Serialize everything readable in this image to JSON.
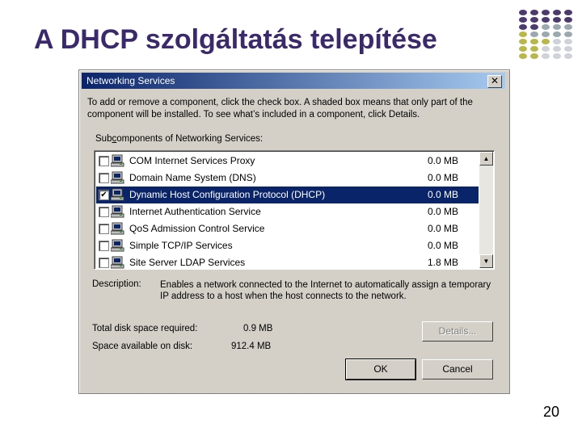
{
  "slide": {
    "title": "A DHCP szolgáltatás telepítése",
    "page_number": "20"
  },
  "dialog": {
    "title": "Networking Services",
    "close_glyph": "✕",
    "description": "To add or remove a component, click the check box. A shaded box means that only part of the component will be installed. To see what’s included in a component, click Details.",
    "subcomponents_label_prefix": "Sub",
    "subcomponents_label_accel": "c",
    "subcomponents_label_rest": "omponents of Networking Services:",
    "components": [
      {
        "name": "COM Internet Services Proxy",
        "size": "0.0 MB",
        "checked": false,
        "selected": false
      },
      {
        "name": "Domain Name System (DNS)",
        "size": "0.0 MB",
        "checked": false,
        "selected": false
      },
      {
        "name": "Dynamic Host Configuration Protocol (DHCP)",
        "size": "0.0 MB",
        "checked": true,
        "selected": true
      },
      {
        "name": "Internet Authentication Service",
        "size": "0.0 MB",
        "checked": false,
        "selected": false
      },
      {
        "name": "QoS Admission Control Service",
        "size": "0.0 MB",
        "checked": false,
        "selected": false
      },
      {
        "name": "Simple TCP/IP Services",
        "size": "0.0 MB",
        "checked": false,
        "selected": false
      },
      {
        "name": "Site Server LDAP Services",
        "size": "1.8 MB",
        "checked": false,
        "selected": false
      }
    ],
    "description_label": "Description:",
    "description_text": "Enables a network connected to the Internet to automatically assign a temporary IP address to a host when the host connects to the network.",
    "total_disk_label": "Total disk space required:",
    "total_disk_value": "0.9 MB",
    "space_available_label": "Space available on disk:",
    "space_available_value": "912.4 MB",
    "details_button": "Details...",
    "ok_button": "OK",
    "cancel_button": "Cancel",
    "check_glyph": "✔",
    "scroll_up_glyph": "▲",
    "scroll_down_glyph": "▼"
  },
  "colors": {
    "title": "#3b2a6b",
    "titlebar_start": "#0a246a",
    "titlebar_end": "#a6caf0",
    "selection": "#0a246a",
    "dialog_face": "#d4d0c8",
    "dot_purple": "#4b3a6e",
    "dot_olive": "#b8b84a",
    "dot_grey": "#9aa8b0",
    "dot_light": "#cfd2d8"
  },
  "icons": {
    "component": "computer-icon",
    "close": "close-icon",
    "check": "checkmark-icon"
  }
}
